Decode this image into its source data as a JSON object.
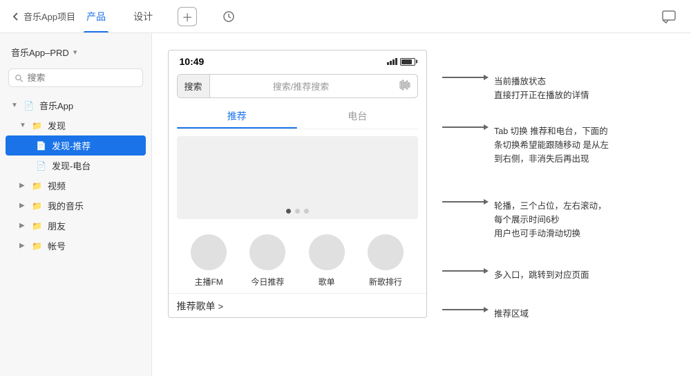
{
  "topBar": {
    "backLabel": "音乐App项目",
    "tabs": [
      {
        "label": "产品",
        "active": true
      },
      {
        "label": "设计",
        "active": false
      }
    ],
    "addIcon": "+",
    "historyIcon": "⏱",
    "chatIcon": "💬"
  },
  "sidebar": {
    "projectLabel": "音乐App–PRD",
    "searchPlaceholder": "搜索",
    "tree": [
      {
        "label": "音乐App",
        "type": "file",
        "indent": 0,
        "toggle": "▼"
      },
      {
        "label": "发现",
        "type": "folder",
        "indent": 1,
        "toggle": "▼"
      },
      {
        "label": "发现-推荐",
        "type": "file",
        "indent": 2,
        "active": true
      },
      {
        "label": "发现-电台",
        "type": "file",
        "indent": 2
      },
      {
        "label": "视频",
        "type": "folder",
        "indent": 1,
        "toggle": "▶"
      },
      {
        "label": "我的音乐",
        "type": "folder",
        "indent": 1,
        "toggle": "▶"
      },
      {
        "label": "朋友",
        "type": "folder",
        "indent": 1,
        "toggle": "▶"
      },
      {
        "label": "帐号",
        "type": "folder",
        "indent": 1,
        "toggle": "▶"
      }
    ]
  },
  "phone": {
    "statusBar": {
      "time": "10:49"
    },
    "searchBar": {
      "label": "搜索",
      "placeholder": "搜索/推荐搜索"
    },
    "tabs": [
      {
        "label": "推荐",
        "active": true
      },
      {
        "label": "电台",
        "active": false
      }
    ],
    "entries": [
      {
        "label": "主播FM"
      },
      {
        "label": "今日推荐"
      },
      {
        "label": "歌单"
      },
      {
        "label": "新歌排行"
      }
    ],
    "recommendTitle": "推荐歌单",
    "recommendMore": ">"
  },
  "annotations": [
    {
      "text": "当前播放状态\n直接打开正在播放的详情"
    },
    {
      "text": "Tab 切换 推荐和电台，下面的\n条切换希望能跟随移动 是从左\n到右侧，非消失后再出现"
    },
    {
      "text": "轮播，三个占位，左右滚动，\n每个展示时间6秒\n用户也可手动滑动切换"
    },
    {
      "text": "多入口，跳转到对应页面"
    },
    {
      "text": "推荐区域"
    }
  ]
}
